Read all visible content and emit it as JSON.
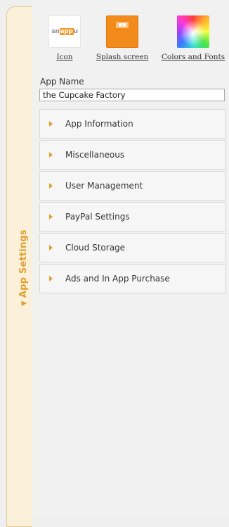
{
  "sidebar_tab": {
    "label": "App Settings",
    "arrow": "▼"
  },
  "thumbnails": {
    "icon": {
      "caption": "Icon",
      "image_text_a": "sn",
      "image_text_b": "app",
      "image_text_c": "u"
    },
    "splash": {
      "caption": "Splash screen"
    },
    "colors": {
      "caption": "Colors and Fonts"
    }
  },
  "app_name": {
    "label": "App Name",
    "value": "the Cupcake Factory"
  },
  "sections": [
    {
      "label": "App Information"
    },
    {
      "label": "Miscellaneous"
    },
    {
      "label": "User Management"
    },
    {
      "label": "PayPal Settings"
    },
    {
      "label": "Cloud Storage"
    },
    {
      "label": "Ads and In App Purchase"
    }
  ],
  "colors": {
    "accent": "#e0a030",
    "tab_bg": "#fbf1da",
    "panel_bg": "#f1f1f1"
  }
}
